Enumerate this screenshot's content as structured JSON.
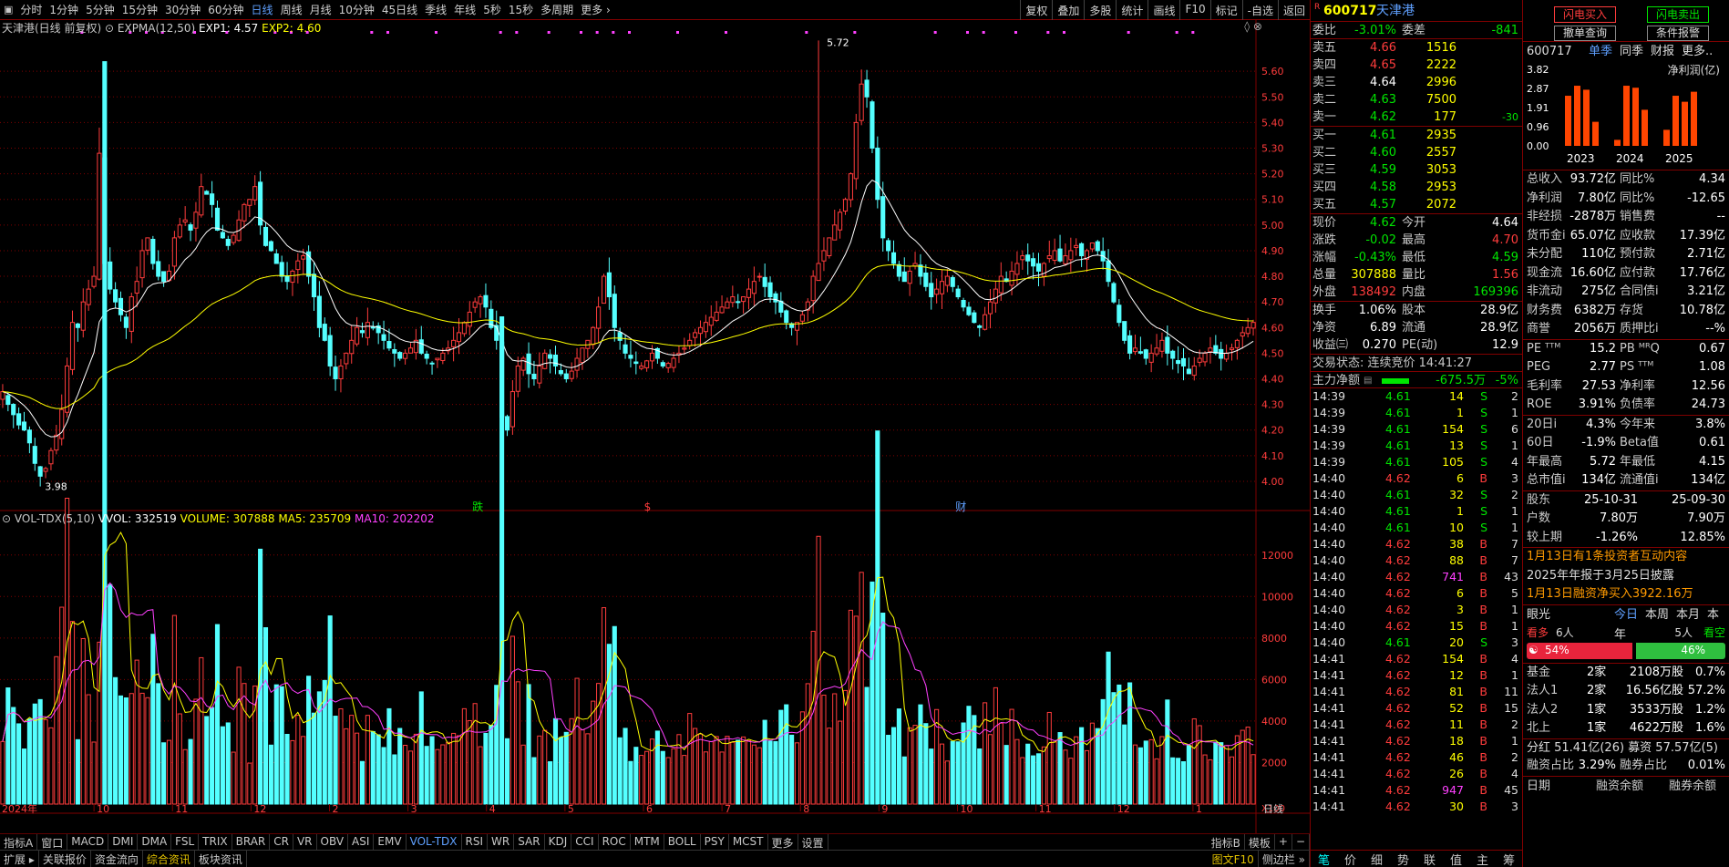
{
  "colors": {
    "up": "#ff3c3c",
    "down": "#54ffff",
    "exp1": "#ffffff",
    "exp2": "#ffff00",
    "ma5": "#ffff00",
    "ma10": "#ff40ff",
    "grid": "#800000"
  },
  "topbar": {
    "periods": [
      "分时",
      "1分钟",
      "5分钟",
      "15分钟",
      "30分钟",
      "60分钟",
      "日线",
      "周线",
      "月线",
      "10分钟",
      "45日线",
      "季线",
      "年线",
      "5秒",
      "15秒",
      "多周期",
      "更多 ›"
    ],
    "active_index": 6,
    "right_buttons": [
      "复权",
      "叠加",
      "多股",
      "统计",
      "画线",
      "F10",
      "标记",
      "-自选",
      "返回"
    ]
  },
  "chart": {
    "title": "天津港(日线 前复权)",
    "indicator": "EXPMA(12,50)",
    "exp1_text": "EXP1: 4.57",
    "exp2_text": "EXP2: 4.60",
    "price_ticks": [
      "5.60",
      "5.50",
      "5.40",
      "5.30",
      "5.20",
      "5.10",
      "5.00",
      "4.90",
      "4.80",
      "4.70",
      "4.60",
      "4.50",
      "4.40",
      "4.30",
      "4.20",
      "4.10",
      "4.00"
    ],
    "max_label": "5.72",
    "min_label": "3.98",
    "markers": [
      {
        "text": "跌",
        "color": "#00e600"
      },
      {
        "text": "$",
        "color": "#ff3c3c"
      },
      {
        "text": "财",
        "color": "#5fa0ff"
      }
    ]
  },
  "chart_data": {
    "type": "bar",
    "title": "天津港(日线 前复权)",
    "ylim": [
      3.95,
      5.75
    ],
    "x_month_labels": [
      "2024年",
      "10",
      "11",
      "12",
      "2",
      "3",
      "4",
      "5",
      "6",
      "7",
      "8",
      "9",
      "10",
      "11",
      "12",
      "1"
    ],
    "closes": [
      4.35,
      4.3,
      4.26,
      4.22,
      4.2,
      4.15,
      4.07,
      4.02,
      4.05,
      4.12,
      4.18,
      4.28,
      4.45,
      4.62,
      4.6,
      4.7,
      4.75,
      4.8,
      5.28,
      4.85,
      4.75,
      4.7,
      4.65,
      4.6,
      4.72,
      4.78,
      4.9,
      4.95,
      4.85,
      4.8,
      4.78,
      4.82,
      4.95,
      5.0,
      5.02,
      4.98,
      5.05,
      5.15,
      5.12,
      5.08,
      4.98,
      4.95,
      4.92,
      4.96,
      5.02,
      5.08,
      5.1,
      5.15,
      5.0,
      4.92,
      4.9,
      4.85,
      4.8,
      4.78,
      4.82,
      4.86,
      4.88,
      4.8,
      4.72,
      4.6,
      4.55,
      4.45,
      4.4,
      4.45,
      4.5,
      4.55,
      4.6,
      4.58,
      4.62,
      4.6,
      4.58,
      4.55,
      4.52,
      4.5,
      4.48,
      4.5,
      4.52,
      4.55,
      4.5,
      4.48,
      4.46,
      4.48,
      4.5,
      4.52,
      4.55,
      4.58,
      4.62,
      4.66,
      4.7,
      4.72,
      4.68,
      4.6,
      4.55,
      4.25,
      4.2,
      4.35,
      4.45,
      4.48,
      4.42,
      4.4,
      4.45,
      4.5,
      4.48,
      4.45,
      4.42,
      4.4,
      4.43,
      4.48,
      4.52,
      4.55,
      4.6,
      4.68,
      4.8,
      4.72,
      4.6,
      4.55,
      4.5,
      4.48,
      4.46,
      4.45,
      4.47,
      4.5,
      4.48,
      4.45,
      4.46,
      4.48,
      4.5,
      4.52,
      4.55,
      4.58,
      4.6,
      4.62,
      4.64,
      4.66,
      4.68,
      4.7,
      4.72,
      4.7,
      4.72,
      4.75,
      4.78,
      4.8,
      4.76,
      4.72,
      4.7,
      4.66,
      4.62,
      4.6,
      4.62,
      4.65,
      4.7,
      4.8,
      4.85,
      4.9,
      4.95,
      5.0,
      5.05,
      5.1,
      5.2,
      5.4,
      5.55,
      5.5,
      5.3,
      5.1,
      4.95,
      4.9,
      4.85,
      4.8,
      4.78,
      4.82,
      4.85,
      4.8,
      4.76,
      4.72,
      4.75,
      4.78,
      4.8,
      4.76,
      4.72,
      4.68,
      4.65,
      4.62,
      4.6,
      4.65,
      4.7,
      4.75,
      4.8,
      4.78,
      4.82,
      4.85,
      4.88,
      4.86,
      4.84,
      4.82,
      4.85,
      4.88,
      4.9,
      4.86,
      4.88,
      4.9,
      4.92,
      4.88,
      4.9,
      4.93,
      4.9,
      4.86,
      4.78,
      4.7,
      4.62,
      4.55,
      4.5,
      4.52,
      4.5,
      4.48,
      4.5,
      4.52,
      4.55,
      4.5,
      4.48,
      4.46,
      4.45,
      4.42,
      4.45,
      4.48,
      4.5,
      4.52,
      4.5,
      4.48,
      4.5,
      4.52,
      4.55,
      4.58,
      4.6,
      4.62
    ],
    "last_close": 4.62,
    "volume": {
      "title": "VOL-TDX(5,10)",
      "wvol": "VVOL: 332519",
      "volume": "VOLUME: 307888",
      "ma5": "MA5: 235709",
      "ma10": "MA10: 202202",
      "yticks": [
        "12000",
        "10000",
        "8000",
        "6000",
        "4000",
        "2000"
      ],
      "unit": "X100",
      "peak": 13000
    }
  },
  "bottombar": {
    "tabs": [
      "指标A",
      "窗口",
      "MACD",
      "DMI",
      "DMA",
      "FSL",
      "TRIX",
      "BRAR",
      "CR",
      "VR",
      "OBV",
      "ASI",
      "EMV",
      "VOL-TDX",
      "RSI",
      "WR",
      "SAR",
      "KDJ",
      "CCI",
      "ROC",
      "MTM",
      "BOLL",
      "PSY",
      "MCST",
      "更多",
      "设置"
    ],
    "active_index": 13,
    "right": [
      "指标B",
      "模板",
      "+",
      "−"
    ],
    "period_label": "日线",
    "row2": [
      "扩展 ▸",
      "关联报价",
      "资金流向",
      "综合资讯",
      "板块资讯"
    ],
    "row2_hl": 3,
    "row2_right": [
      "图文F10",
      "侧边栏 »"
    ]
  },
  "quote": {
    "r_badge": "R",
    "code": "600717",
    "name": "天津港",
    "weibi_label": "委比",
    "weibi": "-3.01%",
    "weicha_label": "委差",
    "weicha": "-841",
    "asks": [
      {
        "l": "卖五",
        "p": "4.66",
        "v": "1516",
        "pc": "red"
      },
      {
        "l": "卖四",
        "p": "4.65",
        "v": "2222",
        "pc": "red"
      },
      {
        "l": "卖三",
        "p": "4.64",
        "v": "2996",
        "pc": "white"
      },
      {
        "l": "卖二",
        "p": "4.63",
        "v": "7500",
        "pc": "green"
      },
      {
        "l": "卖一",
        "p": "4.62",
        "v": "177",
        "pc": "green",
        "c": "-30"
      }
    ],
    "bids": [
      {
        "l": "买一",
        "p": "4.61",
        "v": "2935"
      },
      {
        "l": "买二",
        "p": "4.60",
        "v": "2557"
      },
      {
        "l": "买三",
        "p": "4.59",
        "v": "3053"
      },
      {
        "l": "买四",
        "p": "4.58",
        "v": "2953"
      },
      {
        "l": "买五",
        "p": "4.57",
        "v": "2072"
      }
    ],
    "stats1": [
      {
        "l1": "现价",
        "v1": "4.62",
        "c1": "green",
        "l2": "今开",
        "v2": "4.64",
        "c2": "white"
      },
      {
        "l1": "涨跌",
        "v1": "-0.02",
        "c1": "green",
        "l2": "最高",
        "v2": "4.70",
        "c2": "red"
      },
      {
        "l1": "涨幅",
        "v1": "-0.43%",
        "c1": "green",
        "l2": "最低",
        "v2": "4.59",
        "c2": "green"
      },
      {
        "l1": "总量",
        "v1": "307888",
        "c1": "yellow",
        "l2": "量比",
        "v2": "1.56",
        "c2": "red"
      },
      {
        "l1": "外盘",
        "v1": "138492",
        "c1": "red",
        "l2": "内盘",
        "v2": "169396",
        "c2": "green"
      }
    ],
    "stats2": [
      {
        "l1": "换手",
        "v1": "1.06%",
        "l2": "股本",
        "v2": "28.9亿"
      },
      {
        "l1": "净资",
        "v1": "6.89",
        "l2": "流通",
        "v2": "28.9亿"
      },
      {
        "l1": "收益㈢",
        "v1": "0.270",
        "l2": "PE(动)",
        "v2": "12.9"
      }
    ],
    "trade_status": "交易状态: 连续竞价  14:41:27",
    "main_flow_label": "主力净额",
    "main_flow": "-675.5万",
    "main_flow_pct": "-5%",
    "ticks": [
      [
        "14:39",
        "4.61",
        "14",
        "S",
        "2"
      ],
      [
        "14:39",
        "4.61",
        "1",
        "S",
        "1"
      ],
      [
        "14:39",
        "4.61",
        "154",
        "S",
        "6"
      ],
      [
        "14:39",
        "4.61",
        "13",
        "S",
        "1"
      ],
      [
        "14:39",
        "4.61",
        "105",
        "S",
        "4"
      ],
      [
        "14:40",
        "4.62",
        "6",
        "B",
        "3"
      ],
      [
        "14:40",
        "4.61",
        "32",
        "S",
        "2"
      ],
      [
        "14:40",
        "4.61",
        "1",
        "S",
        "1"
      ],
      [
        "14:40",
        "4.61",
        "10",
        "S",
        "1"
      ],
      [
        "14:40",
        "4.62",
        "38",
        "B",
        "7"
      ],
      [
        "14:40",
        "4.62",
        "88",
        "B",
        "7"
      ],
      [
        "14:40",
        "4.62",
        "741",
        "B",
        "43"
      ],
      [
        "14:40",
        "4.62",
        "6",
        "B",
        "5"
      ],
      [
        "14:40",
        "4.62",
        "3",
        "B",
        "1"
      ],
      [
        "14:40",
        "4.62",
        "15",
        "B",
        "1"
      ],
      [
        "14:40",
        "4.61",
        "20",
        "S",
        "3"
      ],
      [
        "14:41",
        "4.62",
        "154",
        "B",
        "4"
      ],
      [
        "14:41",
        "4.62",
        "12",
        "B",
        "1"
      ],
      [
        "14:41",
        "4.62",
        "81",
        "B",
        "11"
      ],
      [
        "14:41",
        "4.62",
        "52",
        "B",
        "15"
      ],
      [
        "14:41",
        "4.62",
        "11",
        "B",
        "2"
      ],
      [
        "14:41",
        "4.62",
        "18",
        "B",
        "1"
      ],
      [
        "14:41",
        "4.62",
        "46",
        "B",
        "2"
      ],
      [
        "14:41",
        "4.62",
        "26",
        "B",
        "4"
      ],
      [
        "14:41",
        "4.62",
        "947",
        "B",
        "45"
      ],
      [
        "14:41",
        "4.62",
        "30",
        "B",
        "3"
      ]
    ],
    "tabs": [
      "笔",
      "价",
      "细",
      "势",
      "联",
      "值",
      "主",
      "筹"
    ]
  },
  "side": {
    "btn_buy": "闪电买入",
    "btn_sell": "闪电卖出",
    "btn_query": "撤单查询",
    "btn_cond": "条件报警",
    "code": "600717",
    "tabs": [
      "单季",
      "同季",
      "财报",
      "更多.."
    ],
    "metric": "净利润(亿)",
    "bar_ticks": [
      "3.82",
      "2.87",
      "1.91",
      "0.96",
      "0.00"
    ],
    "years": [
      "2023",
      "2024",
      "2025"
    ],
    "bar_values": [
      2.5,
      3.0,
      2.8,
      1.2,
      0.3,
      3.0,
      2.9,
      1.8,
      0.8,
      2.5,
      2.2,
      2.7
    ],
    "fin": [
      [
        "总收入",
        "93.72亿",
        "同比%",
        "4.34"
      ],
      [
        "净利润",
        "7.80亿",
        "同比%",
        "-12.65"
      ],
      [
        "非经损",
        "-2878万",
        "销售费",
        "--"
      ],
      [
        "货币金i",
        "65.07亿",
        "应收款",
        "17.39亿"
      ],
      [
        "未分配",
        "110亿",
        "预付款",
        "2.71亿"
      ],
      [
        "现金流",
        "16.60亿",
        "应付款",
        "17.76亿"
      ],
      [
        "非流动",
        "275亿",
        "合同债i",
        "3.21亿"
      ],
      [
        "财务费",
        "6382万",
        "存货",
        "10.78亿"
      ],
      [
        "商誉",
        "2056万",
        "质押比i",
        "--%"
      ]
    ],
    "val": [
      [
        "PE ᵀᵀᴹ",
        "15.2",
        "PB ᴹᴿQ",
        "0.67"
      ],
      [
        "PEG",
        "2.77",
        "PS ᵀᵀᴹ",
        "1.08"
      ],
      [
        "毛利率",
        "27.53",
        "净利率",
        "12.56"
      ],
      [
        "ROE",
        "3.91%",
        "负债率",
        "24.73"
      ]
    ],
    "perf": [
      [
        "20日i",
        "4.3%",
        "今年来",
        "3.8%"
      ],
      [
        "60日",
        "-1.9%",
        "Beta值",
        "0.61"
      ],
      [
        "年最高",
        "5.72",
        "年最低",
        "4.15"
      ],
      [
        "总市值i",
        "134亿",
        "流通值i",
        "134亿"
      ]
    ],
    "holders": [
      [
        "股东",
        "25-10-31",
        "25-09-30"
      ],
      [
        "户数",
        "7.80万",
        "7.90万"
      ],
      [
        "较上期",
        "-1.26%",
        "12.85%"
      ]
    ],
    "news": [
      "1月13日有1条投资者互动内容",
      "2025年年报于3月25日披露",
      "1月13日融资净买入3922.16万"
    ],
    "eye_label": "眼光",
    "eye_tabs": [
      "今日",
      "本周",
      "本月",
      "本年"
    ],
    "bull_label": "看多",
    "bull_count": "6人",
    "bear_count": "5人",
    "bear_label": "看空",
    "bull_pct": "54%",
    "bear_pct": "46%",
    "bull_frac": 0.54,
    "inst": [
      [
        "基金",
        "2家",
        "2108万股",
        "0.7%"
      ],
      [
        "法人1",
        "2家",
        "16.56亿股",
        "57.2%"
      ],
      [
        "法人2",
        "1家",
        "3533万股",
        "1.2%"
      ],
      [
        "北上",
        "1家",
        "4622万股",
        "1.6%"
      ]
    ],
    "div": "分红  51.41亿(26)  募资  57.57亿(5)",
    "margin": [
      [
        "融资占比",
        "3.29%",
        "融券占比",
        "0.01%"
      ]
    ],
    "foot": [
      "日期",
      "融资余额",
      "融券余额"
    ]
  }
}
